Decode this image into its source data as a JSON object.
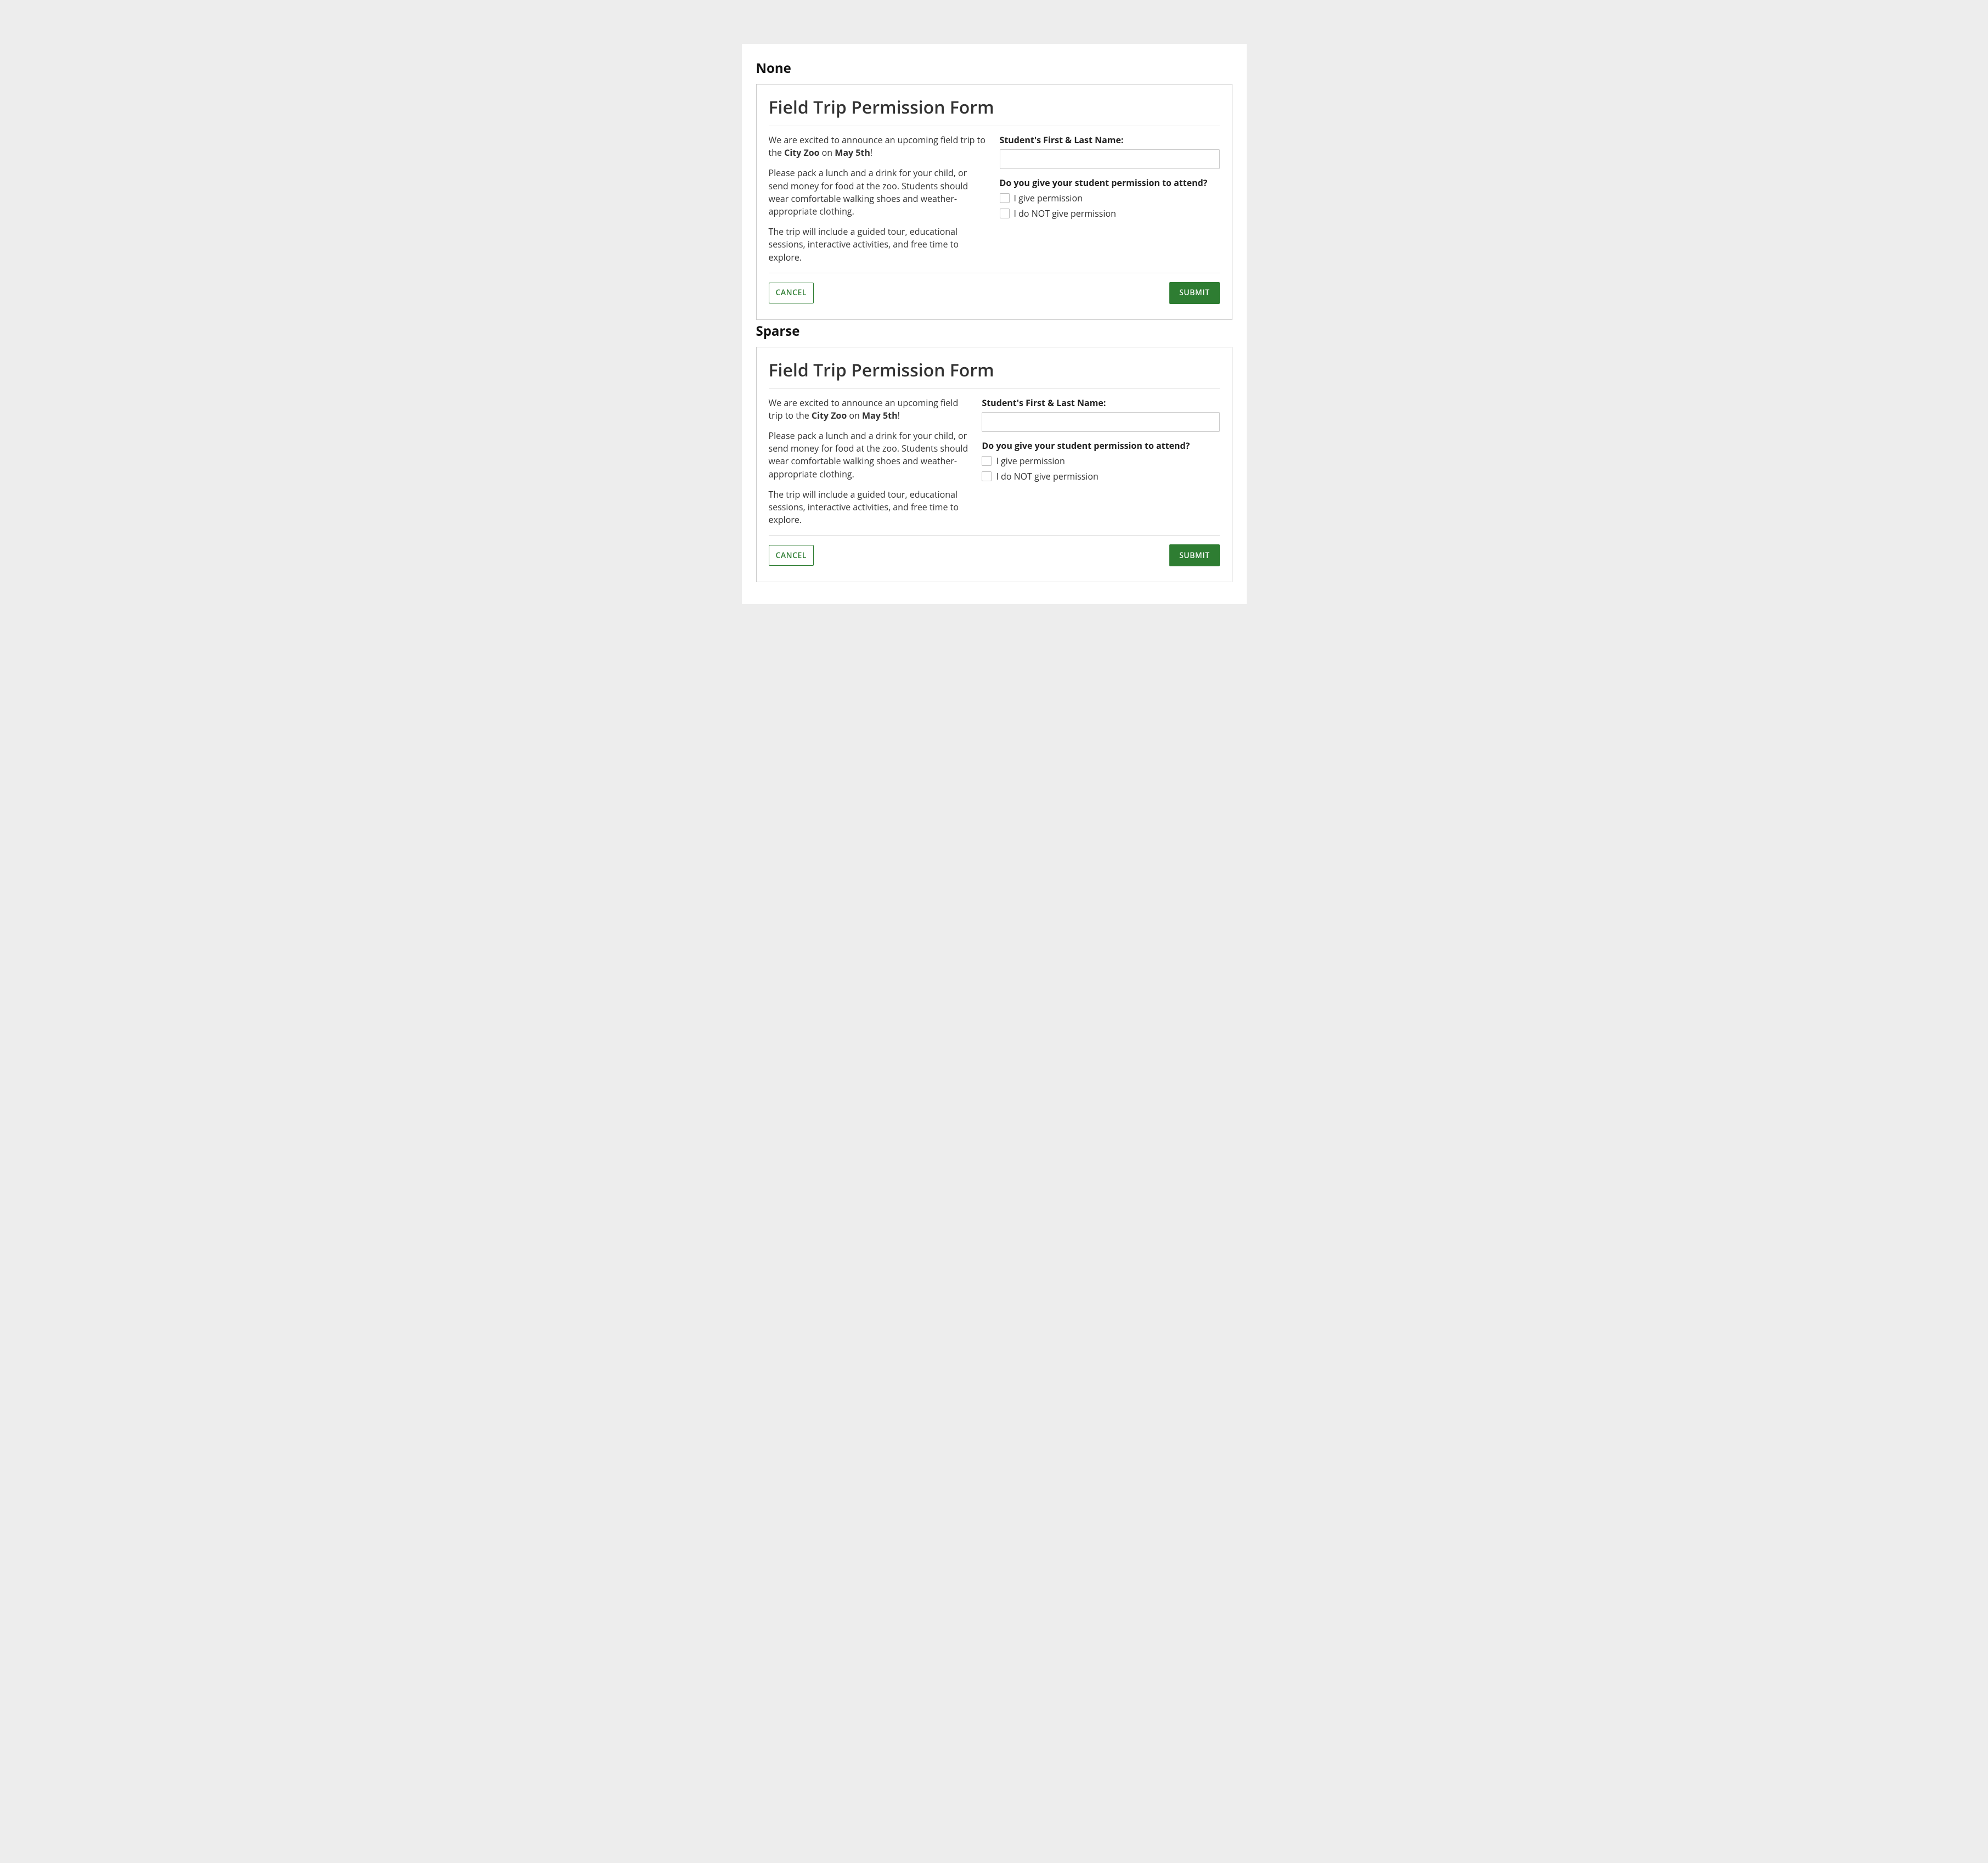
{
  "sections": [
    {
      "heading": "None",
      "title": "Field Trip Permission Form",
      "intro_prefix": "We are excited to announce an upcoming field trip to the ",
      "intro_place": "City Zoo",
      "intro_middle": " on ",
      "intro_date": "May 5th",
      "intro_suffix": "!",
      "p2": "Please pack a lunch and a drink for your child, or send money for food at the zoo. Students should wear comfortable walking shoes and weather-appropriate clothing.",
      "p3": "The trip will include a guided tour, educational sessions, interactive activities, and free time to explore.",
      "name_label": "Student's First & Last Name:",
      "name_value": "",
      "question": "Do you give your student permission to attend?",
      "opt1": "I give permission",
      "opt2": "I do NOT give permission",
      "cancel": "CANCEL",
      "submit": "SUBMIT",
      "layout": "tight"
    },
    {
      "heading": "Sparse",
      "title": "Field Trip Permission Form",
      "intro_prefix": "We are excited to announce an upcoming field trip to the ",
      "intro_place": "City Zoo",
      "intro_middle": " on ",
      "intro_date": "May 5th",
      "intro_suffix": "!",
      "p2": "Please pack a lunch and a drink for your child, or send money for food at the zoo. Students should wear comfortable walking shoes and weather-appropriate clothing.",
      "p3": "The trip will include a guided tour, educational sessions, interactive activities, and free time to explore.",
      "name_label": "Student's First & Last Name:",
      "name_value": "",
      "question": "Do you give your student permission to attend?",
      "opt1": "I give permission",
      "opt2": "I do NOT give permission",
      "cancel": "CANCEL",
      "submit": "SUBMIT",
      "layout": "sparse"
    }
  ]
}
